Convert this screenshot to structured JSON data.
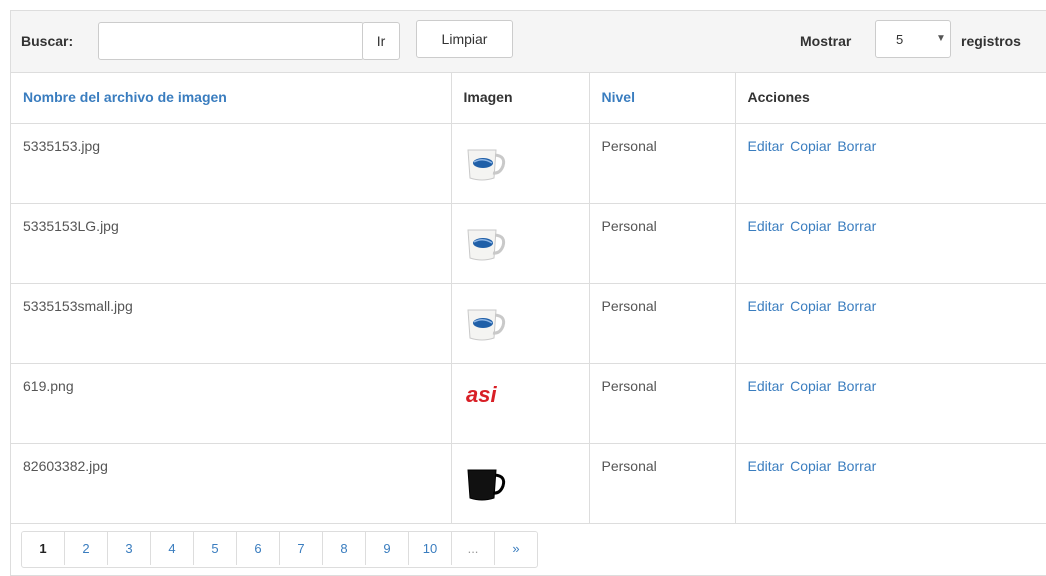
{
  "toolbar": {
    "search_label": "Buscar:",
    "search_value": "",
    "search_placeholder": "",
    "ir_label": "Ir",
    "limpiar_label": "Limpiar",
    "mostrar_label": "Mostrar",
    "page_size": "5",
    "caret": "▼",
    "registros_label": "registros"
  },
  "table": {
    "headers": {
      "filename": "Nombre del archivo de imagen",
      "image": "Imagen",
      "level": "Nivel",
      "actions": "Acciones"
    },
    "rows": [
      {
        "filename": "5335153.jpg",
        "image": "white-mug",
        "level": "Personal"
      },
      {
        "filename": "5335153LG.jpg",
        "image": "white-mug",
        "level": "Personal"
      },
      {
        "filename": "5335153small.jpg",
        "image": "white-mug",
        "level": "Personal"
      },
      {
        "filename": "619.png",
        "image": "asi-logo",
        "level": "Personal"
      },
      {
        "filename": "82603382.jpg",
        "image": "black-mug",
        "level": "Personal"
      }
    ],
    "actions": {
      "edit": "Editar",
      "copy": "Copiar",
      "delete": "Borrar"
    },
    "logo_text": "asi"
  },
  "pagination": {
    "pages": [
      "1",
      "2",
      "3",
      "4",
      "5",
      "6",
      "7",
      "8",
      "9",
      "10",
      "...",
      "»"
    ],
    "active": "1"
  },
  "colors": {
    "link": "#3a7dbf",
    "logo_red": "#d81f26",
    "border": "#dddddd",
    "toolbar_bg": "#f5f5f5"
  }
}
